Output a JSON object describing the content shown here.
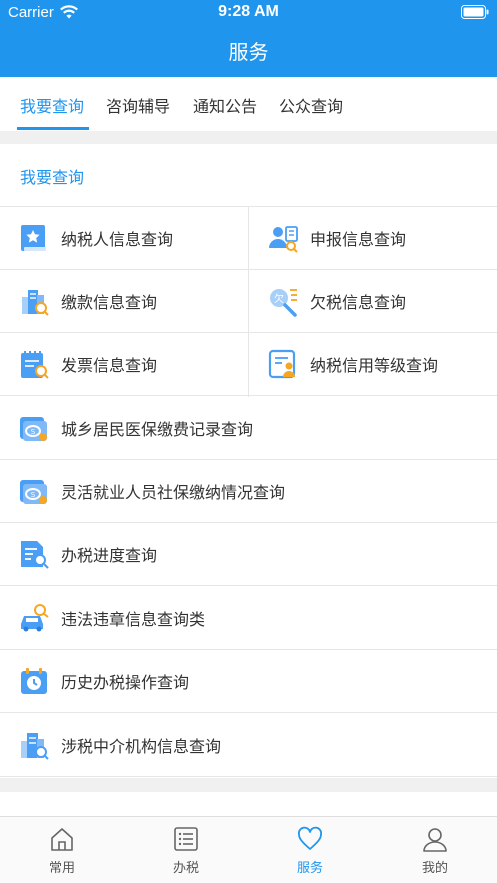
{
  "status_bar": {
    "carrier": "Carrier",
    "time": "9:28 AM"
  },
  "header": {
    "title": "服务"
  },
  "tabs": [
    {
      "label": "我要查询",
      "active": true
    },
    {
      "label": "咨询辅导"
    },
    {
      "label": "通知公告"
    },
    {
      "label": "公众查询"
    }
  ],
  "section": {
    "title": "我要查询"
  },
  "grid_items": [
    {
      "label": "纳税人信息查询",
      "icon": "taxpayer-info-icon"
    },
    {
      "label": "申报信息查询",
      "icon": "declaration-info-icon"
    },
    {
      "label": "缴款信息查询",
      "icon": "payment-info-icon"
    },
    {
      "label": "欠税信息查询",
      "icon": "tax-arrears-icon"
    },
    {
      "label": "发票信息查询",
      "icon": "invoice-info-icon"
    },
    {
      "label": "纳税信用等级查询",
      "icon": "credit-rating-icon"
    }
  ],
  "list_items": [
    {
      "label": "城乡居民医保缴费记录查询",
      "icon": "medical-insurance-icon"
    },
    {
      "label": "灵活就业人员社保缴纳情况查询",
      "icon": "social-insurance-icon"
    },
    {
      "label": "办税进度查询",
      "icon": "progress-icon"
    },
    {
      "label": "违法违章信息查询类",
      "icon": "violation-icon"
    },
    {
      "label": "历史办税操作查询",
      "icon": "history-icon"
    },
    {
      "label": "涉税中介机构信息查询",
      "icon": "agency-icon"
    }
  ],
  "tabbar": [
    {
      "label": "常用",
      "icon": "home-icon"
    },
    {
      "label": "办税",
      "icon": "list-icon"
    },
    {
      "label": "服务",
      "icon": "heart-icon",
      "active": true
    },
    {
      "label": "我的",
      "icon": "user-icon"
    }
  ],
  "colors": {
    "primary": "#1f95ee",
    "icon_blue": "#4a9ff5",
    "icon_orange": "#f5a623",
    "background_gap": "#f0f0f0"
  }
}
